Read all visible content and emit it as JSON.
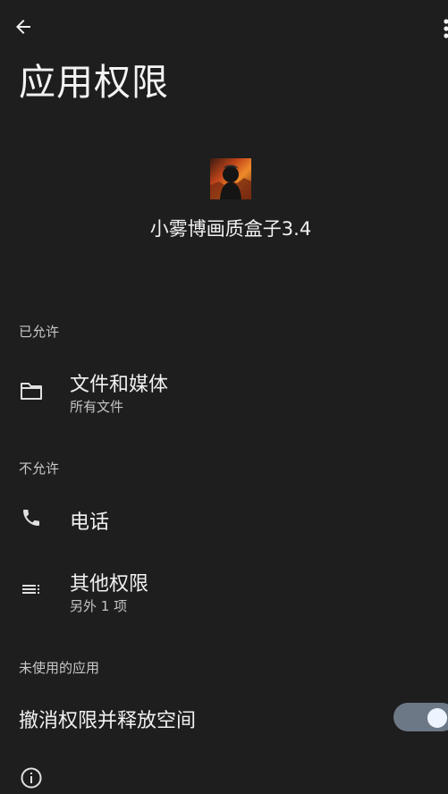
{
  "header": {
    "title": "应用权限",
    "back_icon": "arrow-back-icon",
    "more_icon": "more-vert-icon"
  },
  "app": {
    "name": "小雾博画质盒子3.4",
    "icon": "app-avatar-icon"
  },
  "sections": {
    "allowed": {
      "header": "已允许",
      "items": [
        {
          "title": "文件和媒体",
          "subtitle": "所有文件",
          "icon": "folder-icon"
        }
      ]
    },
    "denied": {
      "header": "不允许",
      "items": [
        {
          "title": "电话",
          "icon": "phone-icon"
        },
        {
          "title": "其他权限",
          "subtitle": "另外 1 项",
          "icon": "list-icon"
        }
      ]
    },
    "unused": {
      "header": "未使用的应用",
      "toggle_label": "撤消权限并释放空间",
      "toggle_on": true
    }
  },
  "footer": {
    "info_icon": "info-icon"
  },
  "colors": {
    "background": "#1e1e1e",
    "toggle_track": "#6d7886",
    "toggle_thumb": "#eef4ff"
  }
}
